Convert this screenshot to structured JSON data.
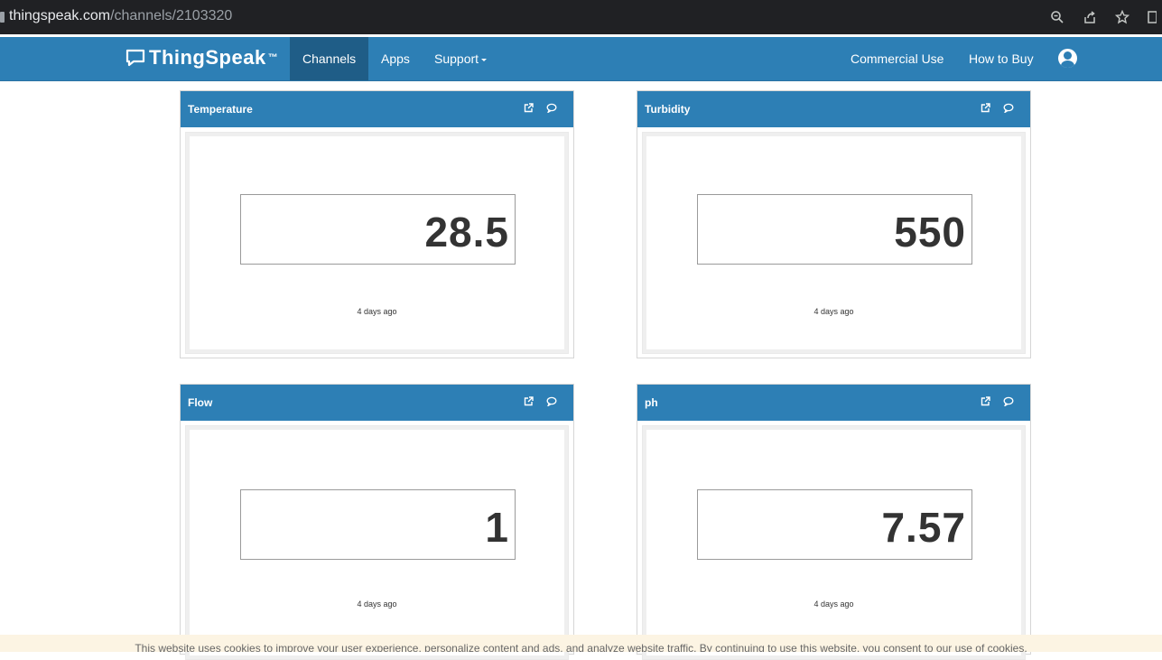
{
  "browser": {
    "url_host": "thingspeak.com",
    "url_path": "/channels/2103320",
    "icons": [
      "zoom-icon",
      "share-icon",
      "bookmark-star-icon",
      "sidebar-icon"
    ]
  },
  "navbar": {
    "brand": "ThingSpeak",
    "brand_tm": "™",
    "items": {
      "channels": "Channels",
      "apps": "Apps",
      "support": "Support",
      "commercial": "Commercial Use",
      "how_to_buy": "How to Buy"
    },
    "colors": {
      "bar": "#2d7fb5",
      "active": "#1f5d87"
    }
  },
  "widgets": [
    {
      "title": "Temperature",
      "value": "28.5",
      "updated": "4 days ago"
    },
    {
      "title": "Turbidity",
      "value": "550",
      "updated": "4 days ago"
    },
    {
      "title": "Flow",
      "value": "1",
      "updated": "4 days ago"
    },
    {
      "title": "ph",
      "value": "7.57",
      "updated": "4 days ago"
    }
  ],
  "cookie_banner": {
    "text": "This website uses cookies to improve your user experience, personalize content and ads, and analyze website traffic. By continuing to use this website, you consent to our use of cookies."
  }
}
